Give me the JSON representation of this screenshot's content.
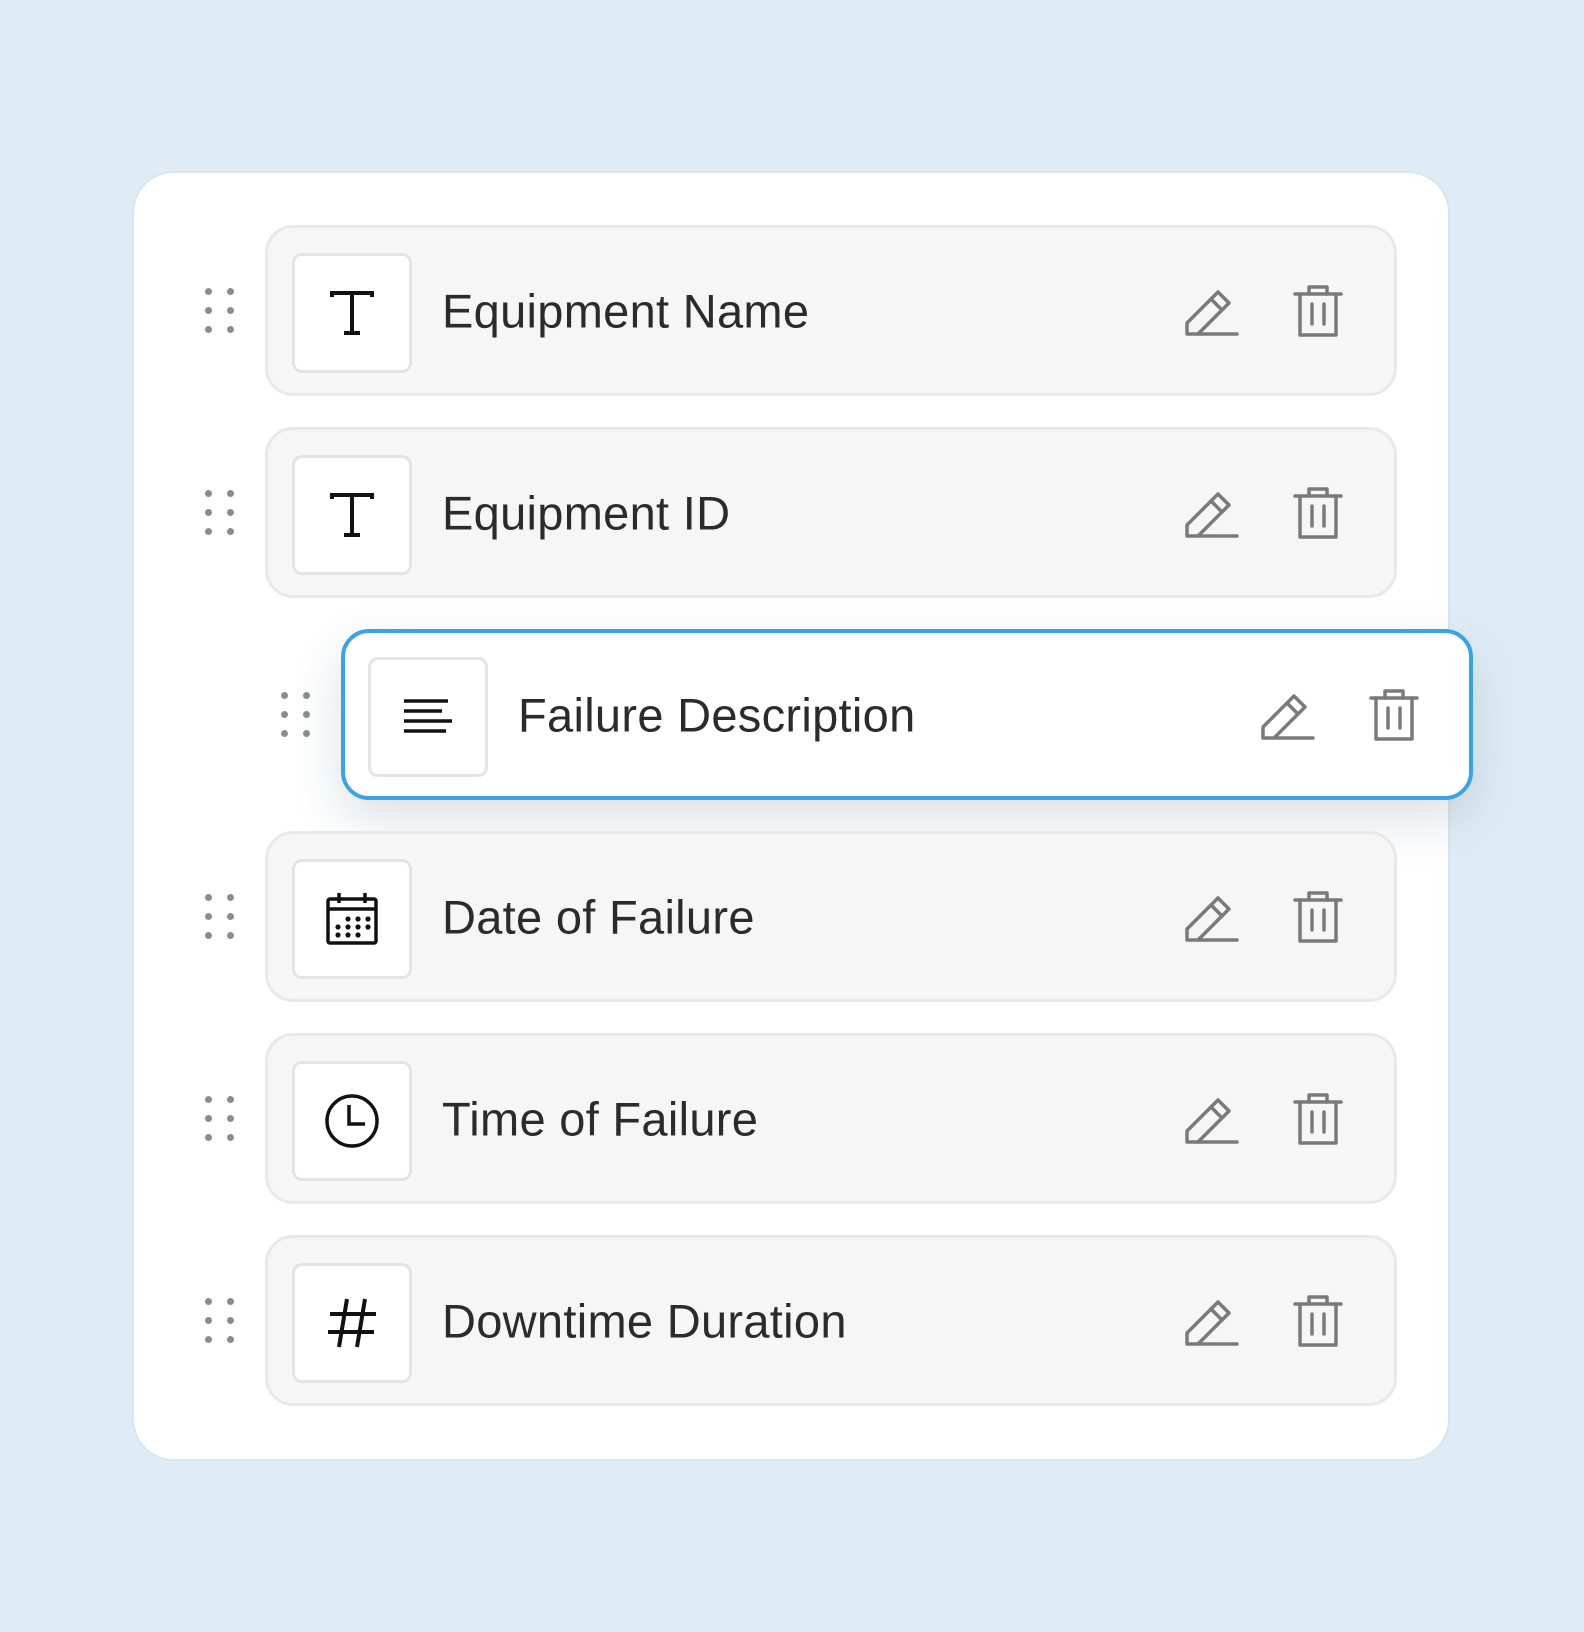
{
  "fields": [
    {
      "label": "Equipment Name",
      "type_icon": "text-type-icon",
      "selected": false
    },
    {
      "label": "Equipment ID",
      "type_icon": "text-type-icon",
      "selected": false
    },
    {
      "label": "Failure Description",
      "type_icon": "paragraph-type-icon",
      "selected": true
    },
    {
      "label": "Date of Failure",
      "type_icon": "calendar-icon",
      "selected": false
    },
    {
      "label": "Time of Failure",
      "type_icon": "clock-icon",
      "selected": false
    },
    {
      "label": "Downtime Duration",
      "type_icon": "hash-icon",
      "selected": false
    }
  ],
  "action_icons": {
    "edit": "pencil-icon",
    "delete": "trash-icon"
  },
  "drag_icon": "drag-handle-icon",
  "colors": {
    "background": "#e0ecf5",
    "panel": "#ffffff",
    "card": "#f6f6f6",
    "card_border": "#e9e9e9",
    "selected_border": "#3aa3e3",
    "label_text": "#2b2b2b",
    "action_icon": "#7a7a7a",
    "type_icon": "#111111",
    "drag_dots": "#8c8c8c"
  }
}
